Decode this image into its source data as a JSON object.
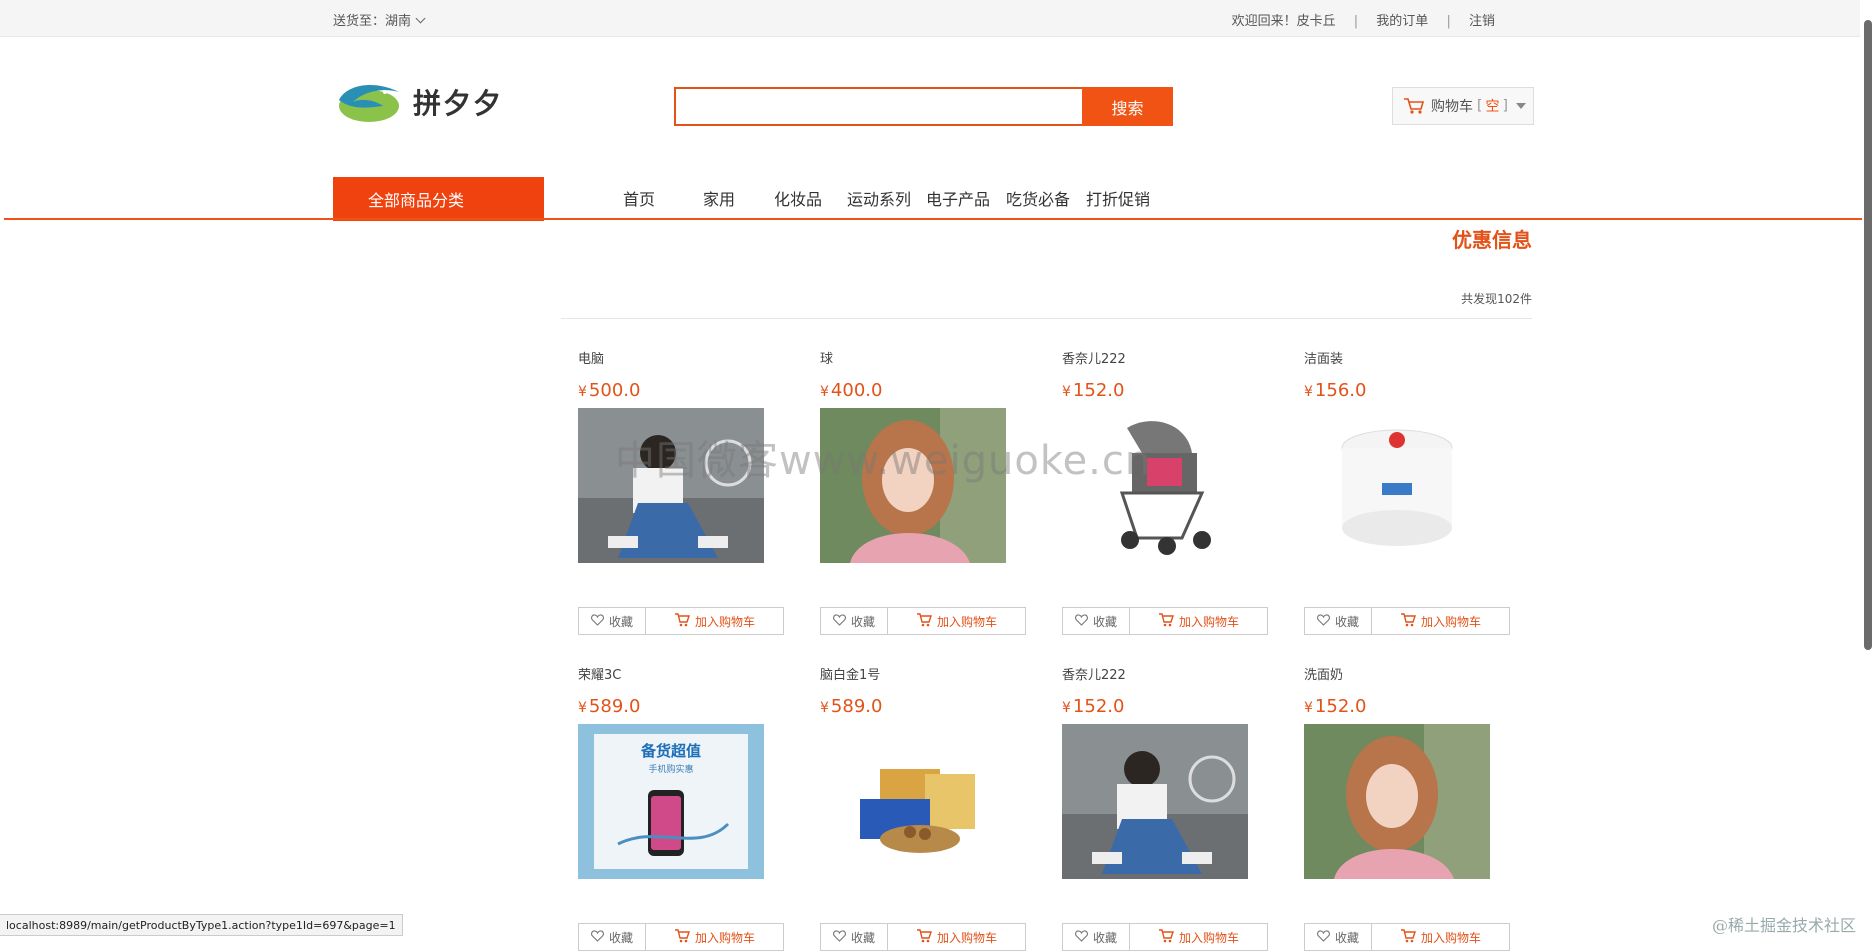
{
  "topbar": {
    "ship_label": "送货至：",
    "ship_region": "湖南",
    "welcome": "欢迎回来！皮卡丘",
    "my_orders": "我的订单",
    "logout": "注销"
  },
  "header": {
    "brand": "拼夕夕",
    "search_placeholder": "",
    "search_button": "搜索",
    "cart_label": "购物车",
    "cart_open": "[",
    "cart_status": "空",
    "cart_close": "]"
  },
  "nav": {
    "all_categories": "全部商品分类",
    "items": [
      "首页",
      "家用",
      "化妆品",
      "运动系列",
      "电子产品",
      "吃货必备",
      "打折促销"
    ]
  },
  "promo": {
    "title": "优惠信息",
    "count_text": "共发现102件"
  },
  "products": [
    {
      "name": "电脑",
      "currency": "¥",
      "price": "500.0",
      "image": "photo-girl-sitting",
      "fav": "收藏",
      "add": "加入购物车"
    },
    {
      "name": "球",
      "currency": "¥",
      "price": "400.0",
      "image": "photo-girl-portrait",
      "fav": "收藏",
      "add": "加入购物车"
    },
    {
      "name": "香奈儿222",
      "currency": "¥",
      "price": "152.0",
      "image": "baby-stroller",
      "fav": "收藏",
      "add": "加入购物车"
    },
    {
      "name": "洁面装",
      "currency": "¥",
      "price": "156.0",
      "image": "baby-powder-jar",
      "fav": "收藏",
      "add": "加入购物车"
    },
    {
      "name": "荣耀3C",
      "currency": "¥",
      "price": "589.0",
      "image": "phone-promo",
      "fav": "收藏",
      "add": "加入购物车",
      "image_text_1": "备货超值",
      "image_text_2": "手机购实惠"
    },
    {
      "name": "脑白金1号",
      "currency": "¥",
      "price": "589.0",
      "image": "snack-packs",
      "fav": "收藏",
      "add": "加入购物车"
    },
    {
      "name": "香奈儿222",
      "currency": "¥",
      "price": "152.0",
      "image": "photo-girl-sitting",
      "fav": "收藏",
      "add": "加入购物车"
    },
    {
      "name": "洗面奶",
      "currency": "¥",
      "price": "152.0",
      "image": "photo-girl-portrait",
      "fav": "收藏",
      "add": "加入购物车"
    }
  ],
  "status_url": "localhost:8989/main/getProductByType1.action?type1Id=697&page=1",
  "watermark_center": "中国微客www.weiguoke.cn",
  "watermark_corner": "@稀土掘金技术社区",
  "colors": {
    "accent": "#f05314",
    "nav_bg": "#f0420e",
    "price": "#e2531a"
  }
}
